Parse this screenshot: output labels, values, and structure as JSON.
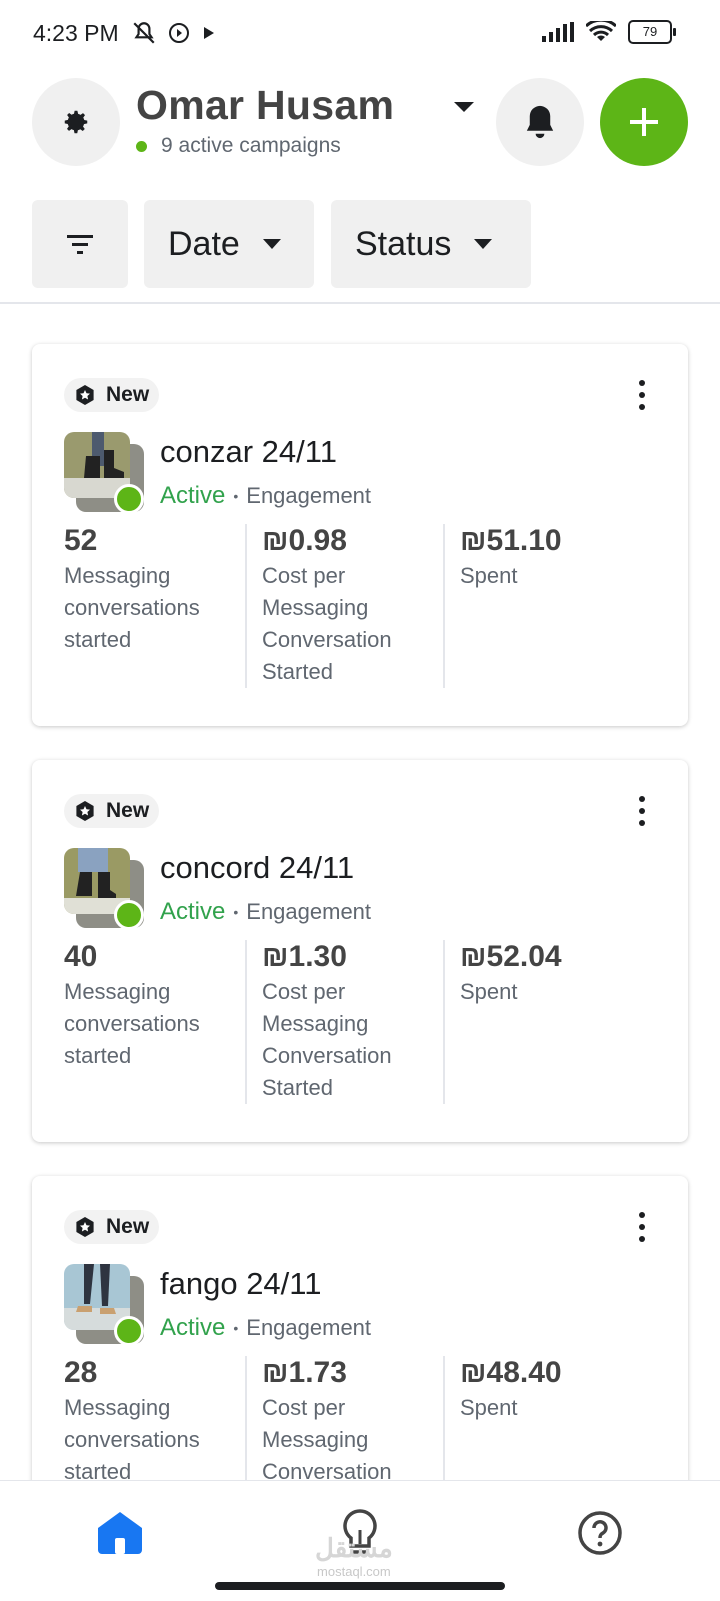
{
  "status_bar": {
    "time": "4:23 PM",
    "battery": "79"
  },
  "header": {
    "account_name": "Omar Husam",
    "account_subtitle": "9 active campaigns"
  },
  "filters": {
    "date_label": "Date",
    "status_label": "Status"
  },
  "campaigns": [
    {
      "badge": "New",
      "name": "conzar 24/11",
      "status": "Active",
      "objective": "Engagement",
      "metrics": [
        {
          "value": "52",
          "label": "Messaging conversations started"
        },
        {
          "value": "₪0.98",
          "label": "Cost per Messaging Conversation Started"
        },
        {
          "value": "₪51.10",
          "label": "Spent"
        }
      ]
    },
    {
      "badge": "New",
      "name": "concord 24/11",
      "status": "Active",
      "objective": "Engagement",
      "metrics": [
        {
          "value": "40",
          "label": "Messaging conversations started"
        },
        {
          "value": "₪1.30",
          "label": "Cost per Messaging Conversation Started"
        },
        {
          "value": "₪52.04",
          "label": "Spent"
        }
      ]
    },
    {
      "badge": "New",
      "name": "fango 24/11",
      "status": "Active",
      "objective": "Engagement",
      "metrics": [
        {
          "value": "28",
          "label": "Messaging conversations started"
        },
        {
          "value": "₪1.73",
          "label": "Cost per Messaging Conversation Started"
        },
        {
          "value": "₪48.40",
          "label": "Spent"
        }
      ]
    }
  ],
  "watermark": {
    "arabic": "مستقل",
    "latin": "mostaql.com"
  },
  "colors": {
    "accent_green": "#5db517",
    "active_text": "#31a24c",
    "home_blue": "#1877f2"
  },
  "icons": {
    "settings": "gear-icon",
    "notifications": "bell-icon",
    "add": "plus-icon",
    "filter": "filter-icon",
    "home": "home-icon",
    "tips": "lightbulb-icon",
    "help": "help-icon"
  }
}
